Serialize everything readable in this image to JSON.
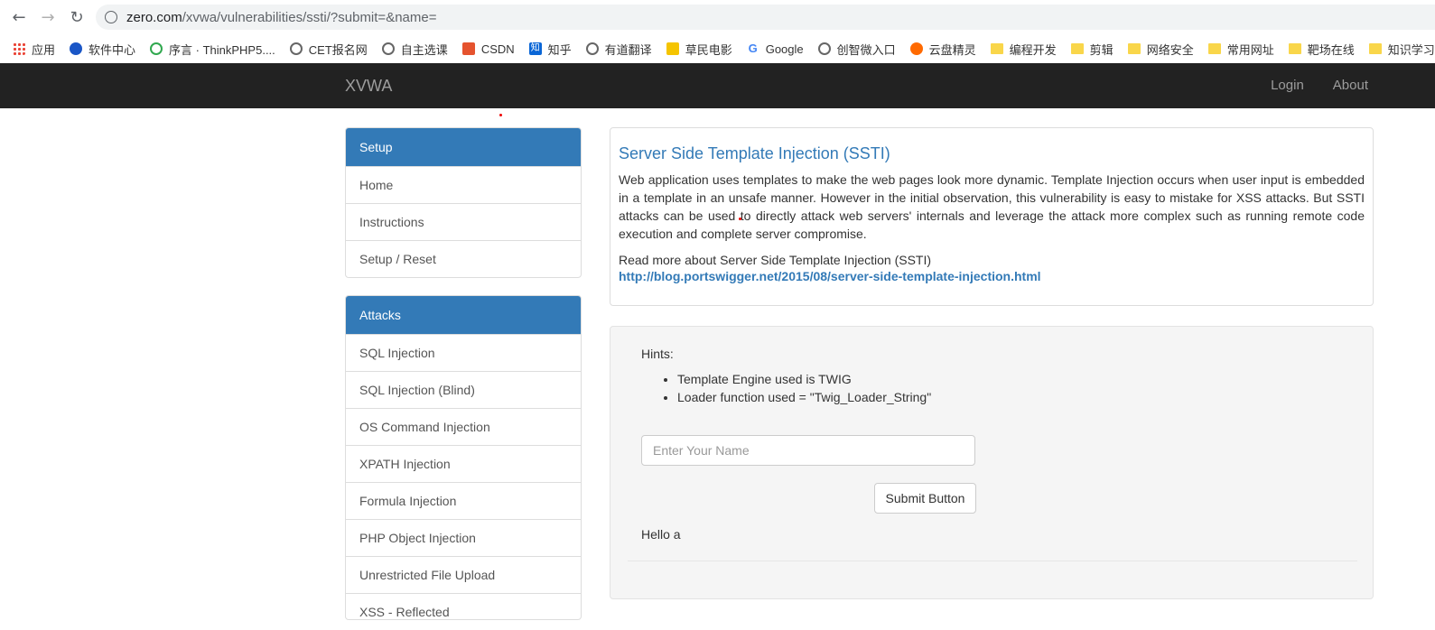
{
  "browser": {
    "url_host": "zero.com",
    "url_path": "/xvwa/vulnerabilities/ssti/?submit=&name=",
    "bookmarks": [
      {
        "label": "应用",
        "icon": "apps-grid-icon"
      },
      {
        "label": "软件中心",
        "icon": "software-center-icon"
      },
      {
        "label": "序言 · ThinkPHP5....",
        "icon": "thinkphp-icon"
      },
      {
        "label": "CET报名网",
        "icon": "globe-icon"
      },
      {
        "label": "自主选课",
        "icon": "globe-icon"
      },
      {
        "label": "CSDN",
        "icon": "csdn-icon"
      },
      {
        "label": "知乎",
        "icon": "zhihu-icon"
      },
      {
        "label": "有道翻译",
        "icon": "globe-icon"
      },
      {
        "label": "草民电影",
        "icon": "movie-icon"
      },
      {
        "label": "Google",
        "icon": "google-icon"
      },
      {
        "label": "创智微入口",
        "icon": "creative-icon"
      },
      {
        "label": "云盘精灵",
        "icon": "cloud-disk-icon"
      },
      {
        "label": "编程开发",
        "icon": "folder-icon"
      },
      {
        "label": "剪辑",
        "icon": "folder-icon"
      },
      {
        "label": "网络安全",
        "icon": "folder-icon"
      },
      {
        "label": "常用网址",
        "icon": "folder-icon"
      },
      {
        "label": "靶场在线",
        "icon": "folder-icon"
      },
      {
        "label": "知识学习",
        "icon": "folder-icon"
      }
    ]
  },
  "navbar": {
    "brand": "XVWA",
    "login": "Login",
    "about": "About"
  },
  "setup_panel": {
    "heading": "Setup",
    "items": [
      "Home",
      "Instructions",
      "Setup / Reset"
    ]
  },
  "attacks_panel": {
    "heading": "Attacks",
    "items": [
      "SQL Injection",
      "SQL Injection (Blind)",
      "OS Command Injection",
      "XPATH Injection",
      "Formula Injection",
      "PHP Object Injection",
      "Unrestricted File Upload",
      "XSS - Reflected"
    ]
  },
  "main": {
    "title": "Server Side Template Injection (SSTI)",
    "description": "Web application uses templates to make the web pages look more dynamic. Template Injection occurs when user input is embedded in a template in an unsafe manner. However in the initial observation, this vulnerability is easy to mistake for XSS attacks. But SSTI attacks can be used to directly attack web servers' internals and leverage the attack more complex such as running remote code execution and complete server compromise.",
    "read_more": "Read more about Server Side Template Injection (SSTI)",
    "link": "http://blog.portswigger.net/2015/08/server-side-template-injection.html"
  },
  "form": {
    "hints_label": "Hints:",
    "hints": [
      "Template Engine used is TWIG",
      "Loader function used = \"Twig_Loader_String\""
    ],
    "name_placeholder": "Enter Your Name",
    "submit_label": "Submit Button",
    "output": "Hello a"
  }
}
